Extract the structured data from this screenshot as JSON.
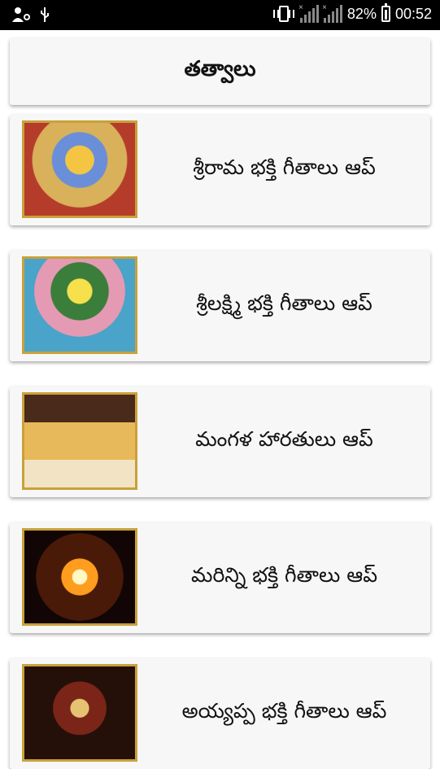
{
  "status_bar": {
    "battery_percent": "82%",
    "time": "00:52",
    "icons": [
      "user-location-icon",
      "usb-icon",
      "vibrate-icon",
      "signal-icon",
      "signal-icon",
      "battery-icon"
    ]
  },
  "header": {
    "title": "తత్వాలు"
  },
  "apps": [
    {
      "label": "శ్రీరామ భక్తి గీతాలు ఆప్",
      "image": "rama-image"
    },
    {
      "label": "శ్రీలక్ష్మి భక్తి గీతాలు ఆప్",
      "image": "lakshmi-image"
    },
    {
      "label": "మంగళ హారతులు ఆప్",
      "image": "mangala-harathulu-image"
    },
    {
      "label": "మరిన్ని భక్తి గీతాలు ఆప్",
      "image": "om-image"
    },
    {
      "label": "అయ్యప్ప భక్తి గీతాలు ఆప్",
      "image": "ayyappa-image"
    }
  ]
}
